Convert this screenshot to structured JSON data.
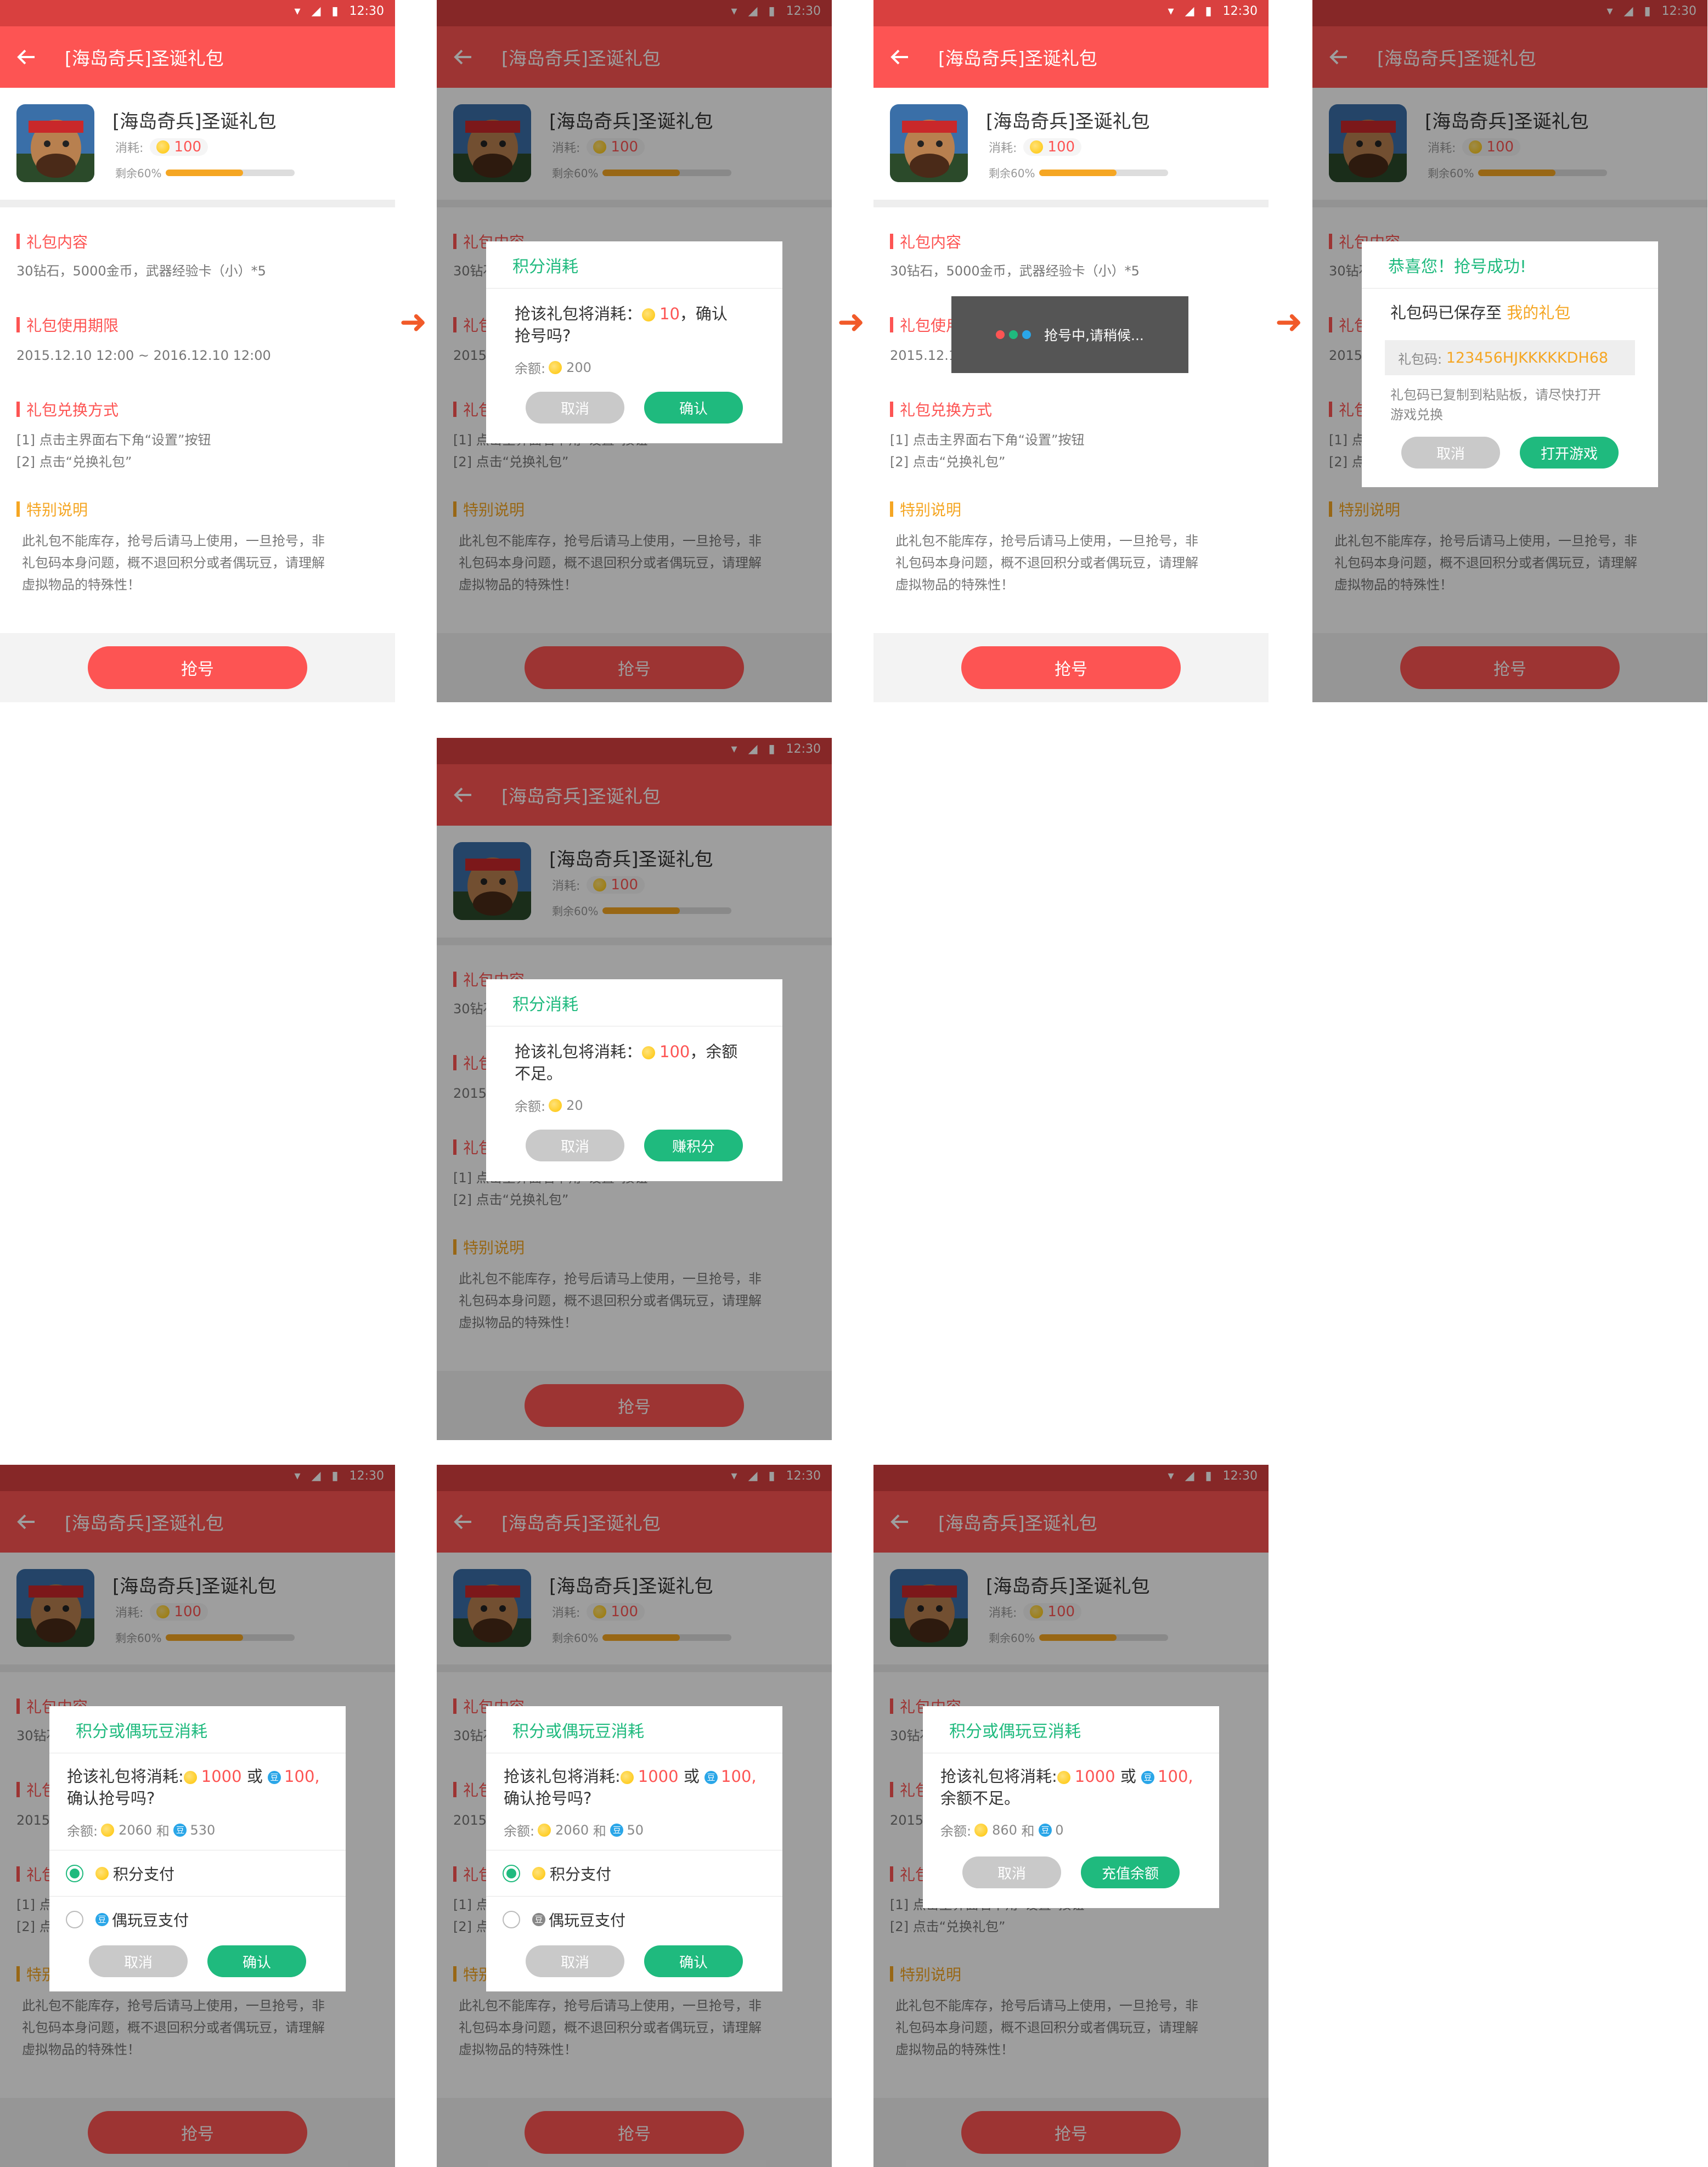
{
  "status": {
    "time": "12:30"
  },
  "app": {
    "title": "[海岛奇兵]圣诞礼包",
    "game_name": "[海岛奇兵]圣诞礼包",
    "cost_label": "消耗:",
    "cost_value": "100",
    "remain_label": "剩余60%",
    "remain_fraction": 0.6
  },
  "sections": {
    "content_title": "礼包内容",
    "content_text": "30钻石，5000金币，武器经验卡（小）*5",
    "period_title": "礼包使用期限",
    "period_text": "2015.12.10   12:00 ~ 2016.12.10   12:00",
    "redeem_title": "礼包兑换方式",
    "redeem_line1": "[1] 点击主界面右下角“设置”按钮",
    "redeem_line2": "[2] 点击“兑换礼包”",
    "note_title": "特别说明",
    "note_line1": "此礼包不能库存，抢号后请马上使用，一旦抢号，非",
    "note_line2": "礼包码本身问题，概不退回积分或者偶玩豆，请理解",
    "note_line3": "虚拟物品的特殊性！"
  },
  "grab_button": "抢号",
  "dialog_points_confirm": {
    "title": "积分消耗",
    "msg_prefix": "抢该礼包将消耗：",
    "cost": "10",
    "msg_suffix": "，确认",
    "msg_line2": "抢号吗?",
    "balance_label": "余额:",
    "balance": "200",
    "cancel": "取消",
    "ok": "确认"
  },
  "toast": {
    "text": "抢号中,请稍候..."
  },
  "dialog_success": {
    "title": "恭喜您！抢号成功!",
    "saved_prefix": "礼包码已保存至",
    "saved_link": "我的礼包",
    "code_label": "礼包码:",
    "code": "123456HJKKKKKDH68",
    "tip_line1": "礼包码已复制到粘贴板，请尽快打开",
    "tip_line2": "游戏兑换",
    "cancel": "取消",
    "open": "打开游戏"
  },
  "dialog_points_insufficient": {
    "title": "积分消耗",
    "msg_prefix": "抢该礼包将消耗：",
    "cost": "100",
    "msg_suffix": "，余额",
    "msg_line2": "不足。",
    "balance_label": "余额:",
    "balance": "20",
    "cancel": "取消",
    "earn": "赚积分"
  },
  "dialog_mixed_a": {
    "title": "积分或偶玩豆消耗",
    "msg_prefix": "抢该礼包将消耗:",
    "points_cost": "1000",
    "or": "或",
    "bean_cost": "100,",
    "msg_line2": "确认抢号吗?",
    "balance_label": "余额:",
    "points_balance": "2060",
    "and": "和",
    "bean_balance": "530",
    "option_points": "积分支付",
    "option_beans": "偶玩豆支付",
    "cancel": "取消",
    "ok": "确认"
  },
  "dialog_mixed_b": {
    "title": "积分或偶玩豆消耗",
    "msg_prefix": "抢该礼包将消耗:",
    "points_cost": "1000",
    "or": "或",
    "bean_cost": "100,",
    "msg_line2": "确认抢号吗?",
    "balance_label": "余额:",
    "points_balance": "2060",
    "and": "和",
    "bean_balance": "50",
    "option_points": "积分支付",
    "option_beans": "偶玩豆支付",
    "cancel": "取消",
    "ok": "确认"
  },
  "dialog_mixed_c": {
    "title": "积分或偶玩豆消耗",
    "msg_prefix": "抢该礼包将消耗:",
    "points_cost": "1000",
    "or": "或",
    "bean_cost": "100,",
    "msg_line2": "余额不足。",
    "balance_label": "余额:",
    "points_balance": "860",
    "and": "和",
    "bean_balance": "0",
    "cancel": "取消",
    "recharge": "充值余额"
  },
  "colors": {
    "accent": "#fd5453",
    "green": "#1fba7e",
    "orange": "#f5a623",
    "arrow": "#f15a29"
  }
}
